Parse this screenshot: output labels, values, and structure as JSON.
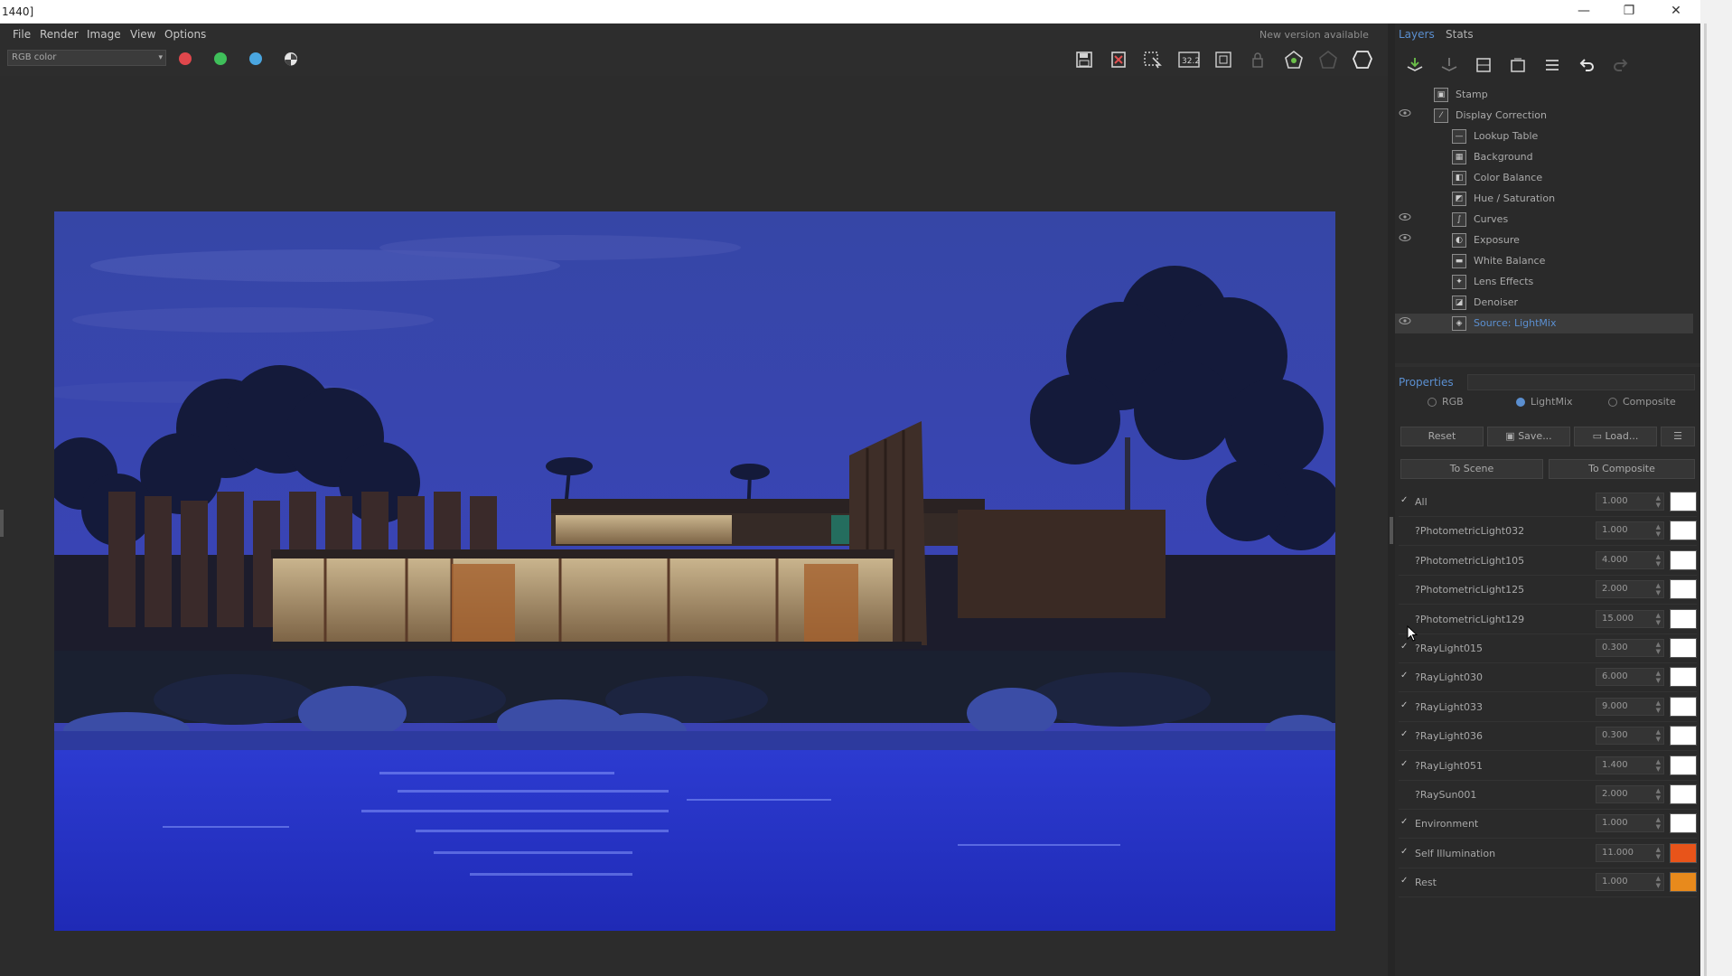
{
  "window": {
    "title": "1440]",
    "minimize_glyph": "—",
    "restore_glyph": "❐",
    "close_glyph": "✕"
  },
  "menu": {
    "items": [
      "File",
      "Render",
      "Image",
      "View",
      "Options"
    ],
    "new_version": "New version available"
  },
  "toolbar": {
    "channel": "RGB color",
    "colors": {
      "red": "#e0474c",
      "green": "#3fbf5a",
      "blue": "#4aa6e0"
    },
    "icons": [
      "save-icon",
      "clear-image-icon",
      "region-render-icon",
      "bit-depth-icon",
      "fit-view-icon",
      "lock-icon",
      "render-icon",
      "disabled-icon",
      "stop-icon"
    ],
    "bit_depth_label": "32.2"
  },
  "panel": {
    "tabs": [
      "Layers",
      "Stats"
    ],
    "active_tab": "Layers",
    "layer_tools": [
      "add-layer-icon",
      "remove-layer-icon",
      "save-layers-icon",
      "load-layers-icon",
      "list-icon",
      "undo-icon",
      "redo-icon"
    ],
    "layers": [
      {
        "name": "Stamp",
        "icon": "▣",
        "eye": false,
        "indent": 1
      },
      {
        "name": "Display Correction",
        "icon": "⁄",
        "eye": true,
        "indent": 1
      },
      {
        "name": "Lookup Table",
        "icon": "—",
        "eye": false,
        "indent": 2
      },
      {
        "name": "Background",
        "icon": "▦",
        "eye": false,
        "indent": 2
      },
      {
        "name": "Color Balance",
        "icon": "◧",
        "eye": false,
        "indent": 2
      },
      {
        "name": "Hue / Saturation",
        "icon": "◩",
        "eye": false,
        "indent": 2
      },
      {
        "name": "Curves",
        "icon": "∫",
        "eye": true,
        "indent": 2
      },
      {
        "name": "Exposure",
        "icon": "◐",
        "eye": true,
        "indent": 2
      },
      {
        "name": "White Balance",
        "icon": "▬",
        "eye": false,
        "indent": 2
      },
      {
        "name": "Lens Effects",
        "icon": "✦",
        "eye": false,
        "indent": 2
      },
      {
        "name": "Denoiser",
        "icon": "◪",
        "eye": false,
        "indent": 2
      },
      {
        "name": "Source: LightMix",
        "icon": "◈",
        "eye": true,
        "indent": 2,
        "selected": true
      }
    ],
    "properties": {
      "title": "Properties",
      "modes": [
        {
          "label": "RGB",
          "on": false
        },
        {
          "label": "LightMix",
          "on": true
        },
        {
          "label": "Composite",
          "on": false
        }
      ],
      "reset": "Reset",
      "save": "Save...",
      "load": "Load...",
      "to_scene": "To Scene",
      "to_composite": "To Composite",
      "lights": [
        {
          "checked": true,
          "name": "All",
          "value": "1.000",
          "color": "#ffffff"
        },
        {
          "checked": false,
          "name": "?PhotometricLight032",
          "value": "1.000",
          "color": "#ffffff"
        },
        {
          "checked": false,
          "name": "?PhotometricLight105",
          "value": "4.000",
          "color": "#ffffff"
        },
        {
          "checked": false,
          "name": "?PhotometricLight125",
          "value": "2.000",
          "color": "#ffffff"
        },
        {
          "checked": false,
          "name": "?PhotometricLight129",
          "value": "15.000",
          "color": "#ffffff"
        },
        {
          "checked": true,
          "name": "?RayLight015",
          "value": "0.300",
          "color": "#ffffff"
        },
        {
          "checked": true,
          "name": "?RayLight030",
          "value": "6.000",
          "color": "#ffffff"
        },
        {
          "checked": true,
          "name": "?RayLight033",
          "value": "9.000",
          "color": "#ffffff"
        },
        {
          "checked": true,
          "name": "?RayLight036",
          "value": "0.300",
          "color": "#ffffff"
        },
        {
          "checked": true,
          "name": "?RayLight051",
          "value": "1.400",
          "color": "#ffffff"
        },
        {
          "checked": false,
          "name": "?RaySun001",
          "value": "2.000",
          "color": "#ffffff"
        },
        {
          "checked": true,
          "name": "Environment",
          "value": "1.000",
          "color": "#ffffff"
        },
        {
          "checked": true,
          "name": "Self Illumination",
          "value": "11.000",
          "color": "#e8541a"
        },
        {
          "checked": true,
          "name": "Rest",
          "value": "1.000",
          "color": "#e88a1c"
        }
      ]
    }
  }
}
